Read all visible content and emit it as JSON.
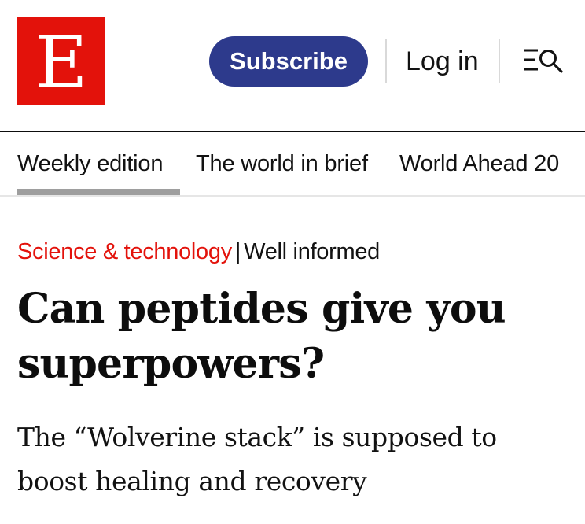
{
  "brand": {
    "logo_letter": "E",
    "color": "#e3120b"
  },
  "header": {
    "subscribe_label": "Subscribe",
    "login_label": "Log in",
    "menu_icon": "menu-search-icon"
  },
  "nav": {
    "tabs": [
      {
        "label": "Weekly edition",
        "active": true
      },
      {
        "label": "The world in brief",
        "active": false
      },
      {
        "label": "World Ahead 20"
      }
    ]
  },
  "article": {
    "section": "Science & technology",
    "separator": "|",
    "fly_title": "Well informed",
    "headline": "Can peptides give you superpowers?",
    "standfirst": "The “Wolverine stack” is supposed to boost healing and recovery"
  },
  "colors": {
    "accent_red": "#e3120b",
    "subscribe_blue": "#2d3a8c"
  }
}
